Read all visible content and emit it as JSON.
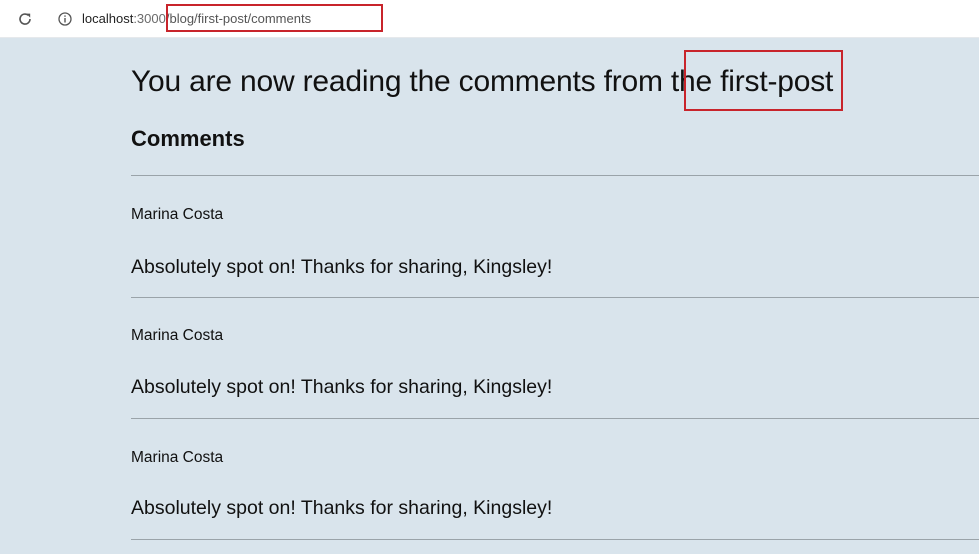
{
  "browser": {
    "url_host": "localhost",
    "url_port": ":3000",
    "url_path": "/blog/first-post/comments",
    "reload_icon": "reload-icon",
    "info_icon": "info-icon"
  },
  "page": {
    "title_prefix": "You are now reading the comments from the ",
    "title_post": "first-post",
    "section_heading": "Comments"
  },
  "comments": [
    {
      "author": "Marina Costa",
      "text": "Absolutely spot on! Thanks for sharing, Kingsley!"
    },
    {
      "author": "Marina Costa",
      "text": "Absolutely spot on! Thanks for sharing, Kingsley!"
    },
    {
      "author": "Marina Costa",
      "text": "Absolutely spot on! Thanks for sharing, Kingsley!"
    }
  ],
  "colors": {
    "page_background": "#d9e4ec",
    "highlight_box": "#c8242b"
  }
}
